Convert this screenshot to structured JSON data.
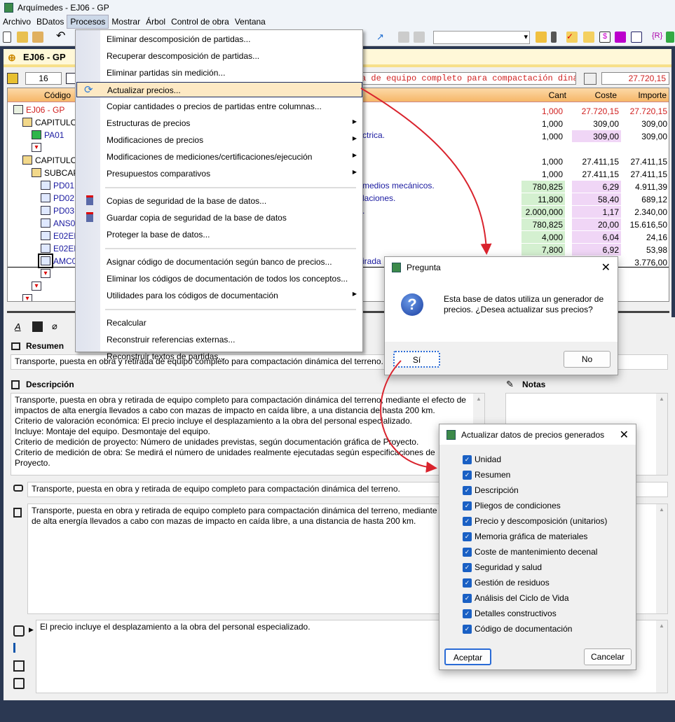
{
  "window": {
    "title": "Arquímedes - EJ06 - GP"
  },
  "menubar": [
    "Archivo",
    "BDatos",
    "Procesos",
    "Mostrar",
    "Árbol",
    "Control de obra",
    "Ventana"
  ],
  "doc": {
    "title": "EJ06 - GP",
    "counter": "16",
    "summary_field": "a de equipo completo para compactación diná",
    "total": "27.720,15"
  },
  "grid": {
    "headers": {
      "code": "Código",
      "cant": "Cant",
      "coste": "Coste",
      "importe": "Importe"
    },
    "rows": [
      {
        "code": "EJ06 - GP",
        "desc": "",
        "cant": "1,000",
        "coste": "27.720,15",
        "importe": "27.720,15",
        "level": 0,
        "type": "root"
      },
      {
        "code": "CAPITULO",
        "desc": "",
        "cant": "1,000",
        "coste": "309,00",
        "importe": "309,00",
        "level": 1,
        "type": "folder"
      },
      {
        "code": "PA01",
        "desc": "ctrica.",
        "cant": "1,000",
        "coste": "309,00",
        "importe": "309,00",
        "level": 2,
        "type": "green",
        "coste_bg": "pink"
      },
      {
        "code": "",
        "desc": "",
        "cant": "",
        "coste": "",
        "importe": "",
        "level": 2,
        "type": "red"
      },
      {
        "code": "CAPITULO",
        "desc": "",
        "cant": "1,000",
        "coste": "27.411,15",
        "importe": "27.411,15",
        "level": 1,
        "type": "folder"
      },
      {
        "code": "SUBCAP",
        "desc": "",
        "cant": "1,000",
        "coste": "27.411,15",
        "importe": "27.411,15",
        "level": 2,
        "type": "folder"
      },
      {
        "code": "PD01",
        "desc": "medios mecánicos.",
        "cant": "780,825",
        "coste": "6,29",
        "importe": "4.911,39",
        "level": 3,
        "type": "item",
        "cant_bg": "green",
        "coste_bg": "pink"
      },
      {
        "code": "PD02",
        "desc": "laciones.",
        "cant": "11,800",
        "coste": "58,40",
        "importe": "689,12",
        "level": 3,
        "type": "item",
        "cant_bg": "green",
        "coste_bg": "pink"
      },
      {
        "code": "PD03",
        "desc": ".",
        "cant": "2.000,000",
        "coste": "1,17",
        "importe": "2.340,00",
        "level": 3,
        "type": "item",
        "cant_bg": "green",
        "coste_bg": "pink"
      },
      {
        "code": "ANS010",
        "desc": "",
        "cant": "780,825",
        "coste": "20,00",
        "importe": "15.616,50",
        "level": 3,
        "type": "item",
        "cant_bg": "green",
        "coste_bg": "pink"
      },
      {
        "code": "E02ERI",
        "desc": "",
        "cant": "4,000",
        "coste": "6,04",
        "importe": "24,16",
        "level": 3,
        "type": "item",
        "cant_bg": "green",
        "coste_bg": "pink"
      },
      {
        "code": "E02ERI",
        "desc": "",
        "cant": "7,800",
        "coste": "6,92",
        "importe": "53,98",
        "level": 3,
        "type": "item",
        "cant_bg": "green",
        "coste_bg": "pink"
      },
      {
        "code": "AMC001",
        "desc": "irada",
        "cant": "",
        "coste": "",
        "importe": "3.776,00",
        "level": 3,
        "type": "item",
        "selected": true
      },
      {
        "code": "",
        "desc": "",
        "cant": "",
        "coste": "",
        "importe": "",
        "level": 3,
        "type": "red"
      },
      {
        "code": "",
        "desc": "",
        "cant": "",
        "coste": "",
        "importe": "",
        "level": 2,
        "type": "red"
      },
      {
        "code": "",
        "desc": "",
        "cant": "",
        "coste": "",
        "importe": "",
        "level": 1,
        "type": "red"
      }
    ]
  },
  "panel": {
    "resumen_label": "Resumen",
    "resumen": "Transporte, puesta en obra y retirada de equipo completo para compactación dinámica del terreno.",
    "descripcion_label": "Descripción",
    "descripcion": "Transporte, puesta en obra y retirada de equipo completo para compactación dinámica del terreno, mediante el efecto de impactos de alta energía llevados a cabo con mazas de impacto en caída libre, a una distancia de hasta 200 km.\nCriterio de valoración económica: El precio incluye el desplazamiento a la obra del personal especializado.\nIncluye: Montaje del equipo. Desmontaje del equipo.\nCriterio de medición de proyecto: Número de unidades previstas, según documentación gráfica de Proyecto.\nCriterio de medición de obra: Se medirá el número de unidades realmente ejecutadas según especificaciones de Proyecto.",
    "notas_label": "Notas",
    "short_text": "Transporte, puesta en obra y retirada de equipo completo para compactación dinámica del terreno.",
    "long_text": "Transporte, puesta en obra y retirada de equipo completo para compactación dinámica del terreno, mediante el efecto de impactos de alta energía llevados a cabo con mazas de impacto en caída libre, a una distancia de hasta 200 km.",
    "criterio_text": "El precio incluye el desplazamiento a la obra del personal especializado."
  },
  "menu": {
    "items": [
      {
        "label": "Eliminar descomposición de partidas..."
      },
      {
        "label": "Recuperar descomposición de partidas..."
      },
      {
        "label": "Eliminar partidas sin medición..."
      },
      {
        "label": "Actualizar precios...",
        "highlighted": true
      },
      {
        "label": "Copiar cantidades o precios de partidas entre columnas..."
      },
      {
        "label": "Estructuras de precios",
        "submenu": true
      },
      {
        "label": "Modificaciones de precios",
        "submenu": true
      },
      {
        "label": "Modificaciones de mediciones/certificaciones/ejecución",
        "submenu": true
      },
      {
        "label": "Presupuestos comparativos",
        "submenu": true
      },
      {
        "separator": true
      },
      {
        "label": "Copias de seguridad de la base de datos..."
      },
      {
        "label": "Guardar copia de seguridad de la base de datos"
      },
      {
        "label": "Proteger la base de datos..."
      },
      {
        "separator": true
      },
      {
        "label": "Asignar código de documentación según banco de precios..."
      },
      {
        "label": "Eliminar los códigos de documentación de todos los conceptos..."
      },
      {
        "label": "Utilidades para los códigos de documentación",
        "submenu": true
      },
      {
        "separator": true
      },
      {
        "label": "Recalcular"
      },
      {
        "label": "Reconstruir referencias externas..."
      },
      {
        "label": "Reconstruir textos de partidas..."
      }
    ]
  },
  "dialog_pregunta": {
    "title": "Pregunta",
    "message": "Esta base de datos utiliza un generador de precios. ¿Desea actualizar sus precios?",
    "yes": "Sí",
    "no": "No"
  },
  "dialog_actualizar": {
    "title": "Actualizar datos de precios generados",
    "options": [
      "Unidad",
      "Resumen",
      "Descripción",
      "Pliegos de condiciones",
      "Precio y descomposición (unitarios)",
      "Memoria gráfica de materiales",
      "Coste de mantenimiento decenal",
      "Seguridad y salud",
      "Gestión de residuos",
      "Análisis del Ciclo de Vida",
      "Detalles constructivos",
      "Código de documentación"
    ],
    "accept": "Aceptar",
    "cancel": "Cancelar"
  },
  "colors": {
    "accent_red": "#d9232d",
    "navy": "#2b3852",
    "grid_green": "#d4f0d0",
    "grid_pink": "#f0d6f6",
    "header_orange": "#f6b768"
  }
}
